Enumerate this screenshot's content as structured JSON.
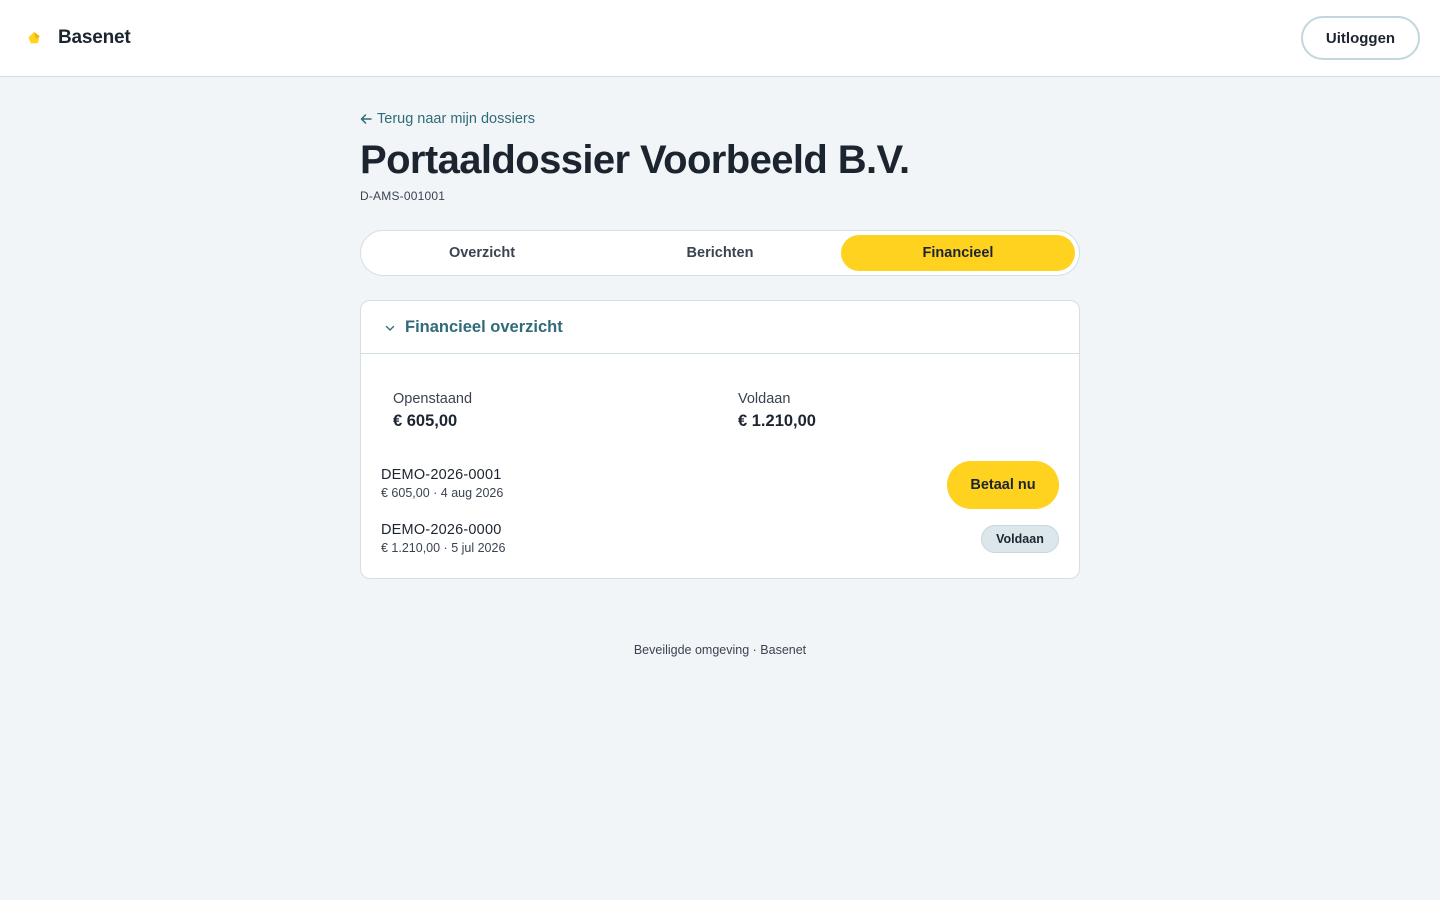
{
  "brand": {
    "name": "Basenet",
    "accent": "#ffd21f"
  },
  "header": {
    "logout_label": "Uitloggen"
  },
  "nav": {
    "back_label": "Terug naar mijn dossiers",
    "back_icon": "arrow-left-icon"
  },
  "dossier": {
    "title": "Portaaldossier Voorbeeld B.V.",
    "id": "D-AMS-001001"
  },
  "tabs": [
    {
      "label": "Overzicht",
      "active": false
    },
    {
      "label": "Berichten",
      "active": false
    },
    {
      "label": "Financieel",
      "active": true
    }
  ],
  "finance": {
    "section_title": "Financieel overzicht",
    "section_icon": "chevron-down-icon",
    "open_label": "Openstaand",
    "open_value": "€ 605,00",
    "paid_label": "Voldaan",
    "paid_value": "€ 1.210,00",
    "invoices": [
      {
        "id": "DEMO-2026-0001",
        "meta": "€ 605,00 · 4 aug 2026",
        "action_label": "Betaal nu"
      },
      {
        "id": "DEMO-2026-0000",
        "meta": "€ 1.210,00 · 5 jul 2026",
        "status_label": "Voldaan"
      }
    ]
  },
  "footer": {
    "text": "Beveiligde omgeving · Basenet"
  }
}
